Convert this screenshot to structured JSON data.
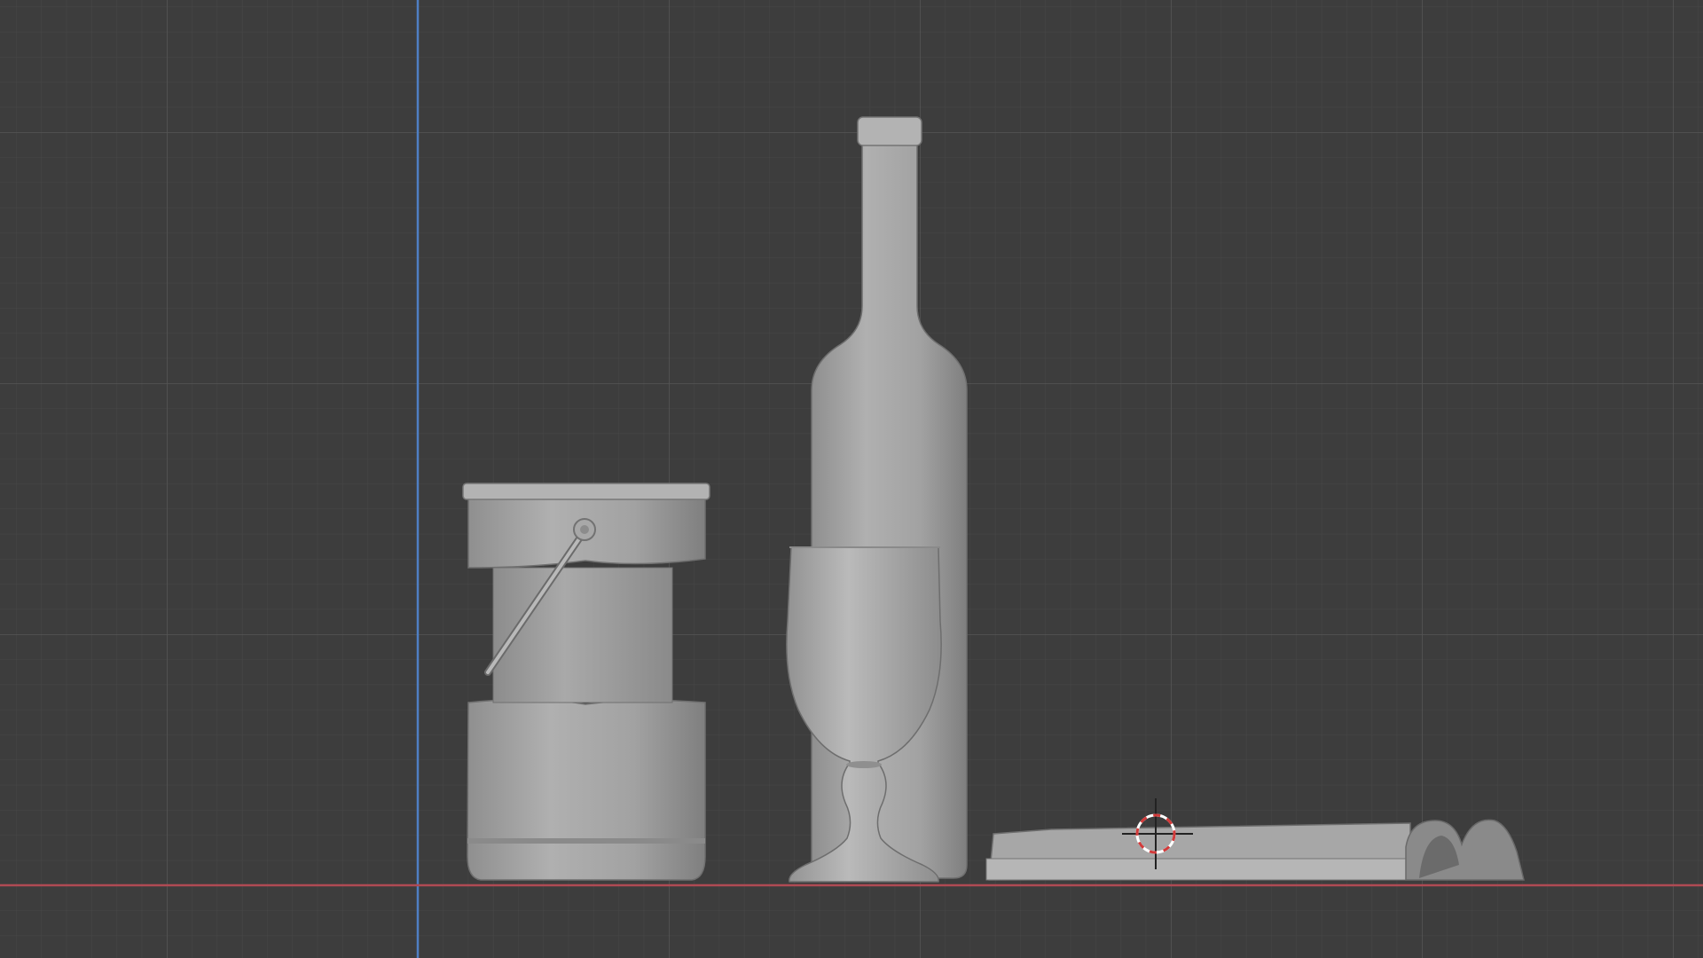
{
  "viewport": {
    "view": "front-orthographic",
    "background": "#3d3d3d",
    "grid_minor_color": "#454545",
    "grid_major_color": "#525252",
    "x_axis_color": "#b04a54",
    "z_axis_color": "#4f7fc4",
    "shading": "solid",
    "mesh_color": "#9a9a9a"
  },
  "scene": {
    "objects": [
      {
        "name": "bucket",
        "icon": "bucket-mesh"
      },
      {
        "name": "bottle",
        "icon": "bottle-mesh"
      },
      {
        "name": "goblet",
        "icon": "goblet-mesh"
      },
      {
        "name": "book",
        "icon": "book-mesh"
      }
    ],
    "cursor_icon": "3d-cursor-icon"
  }
}
